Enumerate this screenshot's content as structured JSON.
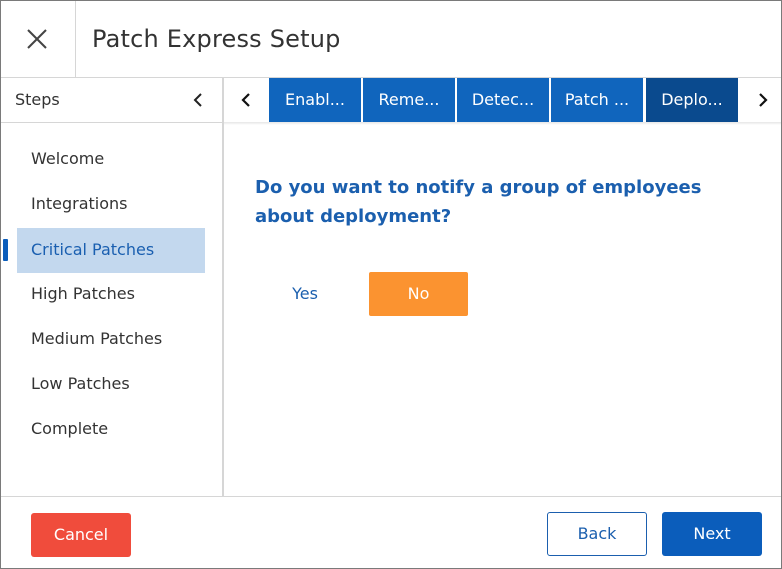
{
  "header": {
    "title": "Patch Express Setup"
  },
  "sidebar": {
    "heading": "Steps",
    "items": [
      {
        "label": "Welcome"
      },
      {
        "label": "Integrations"
      },
      {
        "label": "Critical Patches"
      },
      {
        "label": "High Patches"
      },
      {
        "label": "Medium Patches"
      },
      {
        "label": "Low Patches"
      },
      {
        "label": "Complete"
      }
    ],
    "active_index": 2
  },
  "tabs": [
    {
      "label": "Enabl..."
    },
    {
      "label": "Reme..."
    },
    {
      "label": "Detec..."
    },
    {
      "label": "Patch ..."
    },
    {
      "label": "Deplo..."
    }
  ],
  "main": {
    "question": "Do you want to notify a group of employees about deployment?",
    "yes_label": "Yes",
    "no_label": "No"
  },
  "footer": {
    "cancel_label": "Cancel",
    "back_label": "Back",
    "next_label": "Next"
  },
  "colors": {
    "primary": "#0b5dbb",
    "tab": "#1065bd",
    "tab_current": "#0a4a8e",
    "active_step_bg": "#c3d8ee",
    "no_button": "#fb9330",
    "cancel_button": "#f04c3c",
    "question_text": "#1b5fae"
  },
  "icons": {
    "close": "close-icon",
    "collapse": "chevron-left-icon",
    "tab_prev": "chevron-left-icon",
    "tab_next": "chevron-right-icon"
  }
}
